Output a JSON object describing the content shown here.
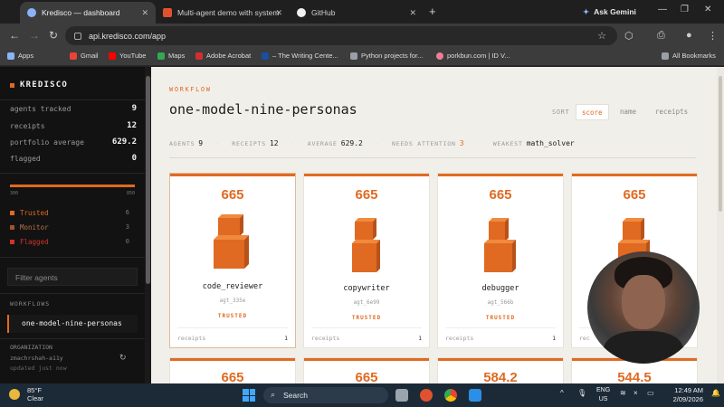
{
  "browser": {
    "tabs": [
      {
        "title": "Kredisco — dashboard",
        "active": true
      },
      {
        "title": "Multi-agent demo with system",
        "active": false
      },
      {
        "title": "GitHub",
        "active": false
      }
    ],
    "ask_gemini": "Ask Gemini",
    "url": "api.kredisco.com/app",
    "bookmarks": [
      "Apps",
      "Gmail",
      "YouTube",
      "Maps",
      "Adobe Acrobat",
      "– The Writing Cente...",
      "Python projects for...",
      "porkbun.com | ID V...",
      "All Bookmarks"
    ]
  },
  "sidebar": {
    "brand": "KREDISCO",
    "stats": [
      {
        "label": "agents tracked",
        "value": "9"
      },
      {
        "label": "receipts",
        "value": "12"
      },
      {
        "label": "portfolio average",
        "value": "629.2"
      },
      {
        "label": "flagged",
        "value": "0"
      }
    ],
    "bar_min": "300",
    "bar_max": "850",
    "legend": [
      {
        "label": "Trusted",
        "count": "6",
        "color": "#e06a21"
      },
      {
        "label": "Monitor",
        "count": "3",
        "color": "#a0522d"
      },
      {
        "label": "Flagged",
        "count": "0",
        "color": "#d0342c"
      }
    ],
    "filter_placeholder": "Filter agents",
    "workflows_header": "WORKFLOWS",
    "workflow_item": "one-model-nine-personas",
    "org_header": "ORGANIZATION",
    "org_name": "zmachrshah-a11y",
    "org_updated": "updated just now"
  },
  "main": {
    "eyebrow": "WORKFLOW",
    "title": "one-model-nine-personas",
    "sort_label": "SORT",
    "sort_options": [
      "score",
      "name",
      "receipts"
    ],
    "metrics": [
      {
        "label": "AGENTS",
        "value": "9"
      },
      {
        "label": "RECEIPTS",
        "value": "12"
      },
      {
        "label": "AVERAGE",
        "value": "629.2"
      },
      {
        "label": "NEEDS ATTENTION",
        "value": "3"
      },
      {
        "label": "WEAKEST",
        "value": "math_solver"
      }
    ],
    "cards": [
      {
        "score": "665",
        "name": "code_reviewer",
        "id": "agt_335e",
        "status": "TRUSTED",
        "receipts_label": "receipts",
        "receipts": "1"
      },
      {
        "score": "665",
        "name": "copywriter",
        "id": "agt_6e99",
        "status": "TRUSTED",
        "receipts_label": "receipts",
        "receipts": "1"
      },
      {
        "score": "665",
        "name": "debugger",
        "id": "agt_566b",
        "status": "TRUSTED",
        "receipts_label": "receipts",
        "receipts": "1"
      },
      {
        "score": "665",
        "name": "",
        "id": "",
        "status": "",
        "receipts_label": "rec",
        "receipts": ""
      }
    ],
    "row2_scores": [
      "665",
      "665",
      "584.2",
      "544.5"
    ]
  },
  "taskbar": {
    "temp": "85°F",
    "condition": "Clear",
    "search": "Search",
    "lang1": "ENG",
    "lang2": "US",
    "time": "12:49 AM",
    "date": "2/09/2026"
  }
}
